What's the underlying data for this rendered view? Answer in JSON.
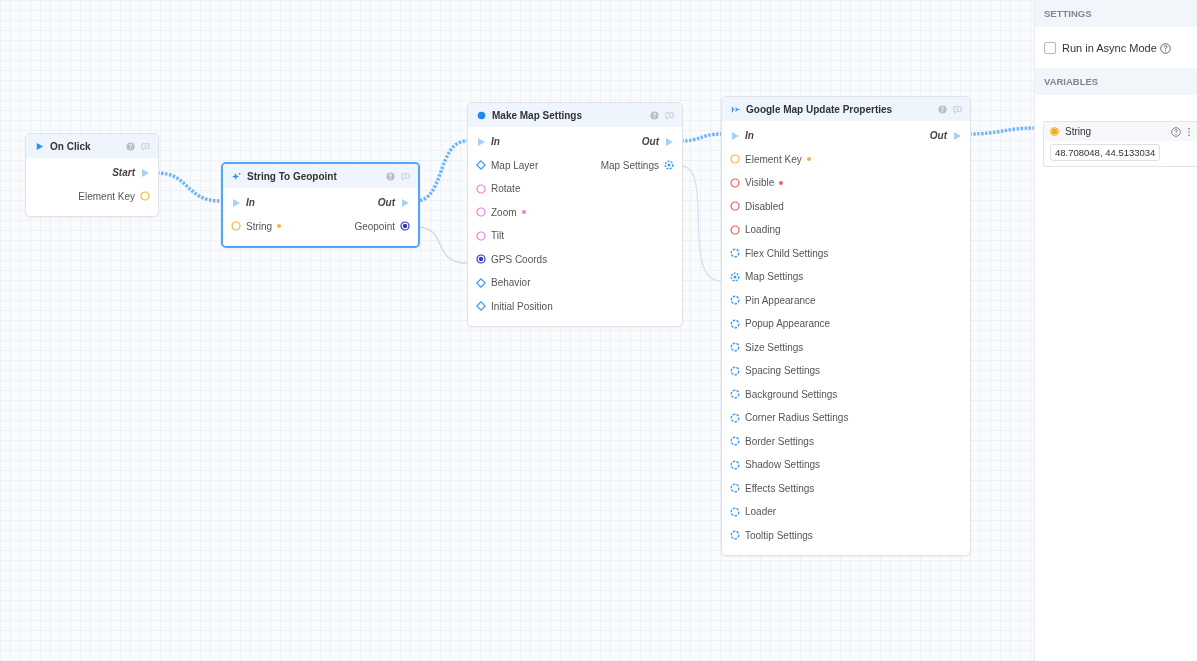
{
  "canvas": {
    "nodes": [
      {
        "title": "On Click",
        "selected": false,
        "outputs": [
          {
            "label": "Start",
            "kind": "exec",
            "required": false
          },
          {
            "label": "Element Key",
            "kind": "text",
            "required": false
          }
        ]
      },
      {
        "title": "String To Geopoint",
        "selected": true,
        "inputs": [
          {
            "label": "In",
            "kind": "exec",
            "required": false
          },
          {
            "label": "String",
            "kind": "text",
            "required": true
          }
        ],
        "outputs": [
          {
            "label": "Out",
            "kind": "exec",
            "required": false
          },
          {
            "label": "Geopoint",
            "kind": "geopoint",
            "required": false
          }
        ]
      },
      {
        "title": "Make Map Settings",
        "selected": false,
        "inputs": [
          {
            "label": "In",
            "kind": "exec",
            "required": false
          },
          {
            "label": "Map Layer",
            "kind": "enum",
            "required": false
          },
          {
            "label": "Rotate",
            "kind": "number",
            "required": false
          },
          {
            "label": "Zoom",
            "kind": "number",
            "required": true
          },
          {
            "label": "Tilt",
            "kind": "number",
            "required": false
          },
          {
            "label": "GPS Coords",
            "kind": "geopoint",
            "required": false
          },
          {
            "label": "Behavior",
            "kind": "enum",
            "required": false
          },
          {
            "label": "Initial Position",
            "kind": "enum",
            "required": false
          }
        ],
        "outputs": [
          {
            "label": "Out",
            "kind": "exec",
            "required": false
          },
          {
            "label": "Map Settings",
            "kind": "map",
            "required": false
          }
        ]
      },
      {
        "title": "Google Map Update Properties",
        "selected": false,
        "inputs": [
          {
            "label": "In",
            "kind": "exec",
            "required": false
          },
          {
            "label": "Element Key",
            "kind": "text",
            "required": true
          },
          {
            "label": "Visible",
            "kind": "boolean",
            "required": true
          },
          {
            "label": "Disabled",
            "kind": "boolean",
            "required": false
          },
          {
            "label": "Loading",
            "kind": "boolean",
            "required": false
          },
          {
            "label": "Flex Child Settings",
            "kind": "object",
            "required": false
          },
          {
            "label": "Map Settings",
            "kind": "map",
            "required": false
          },
          {
            "label": "Pin Appearance",
            "kind": "object",
            "required": false
          },
          {
            "label": "Popup Appearance",
            "kind": "object",
            "required": false
          },
          {
            "label": "Size Settings",
            "kind": "object",
            "required": false
          },
          {
            "label": "Spacing Settings",
            "kind": "object",
            "required": false
          },
          {
            "label": "Background Settings",
            "kind": "object",
            "required": false
          },
          {
            "label": "Corner Radius Settings",
            "kind": "object",
            "required": false
          },
          {
            "label": "Border Settings",
            "kind": "object",
            "required": false
          },
          {
            "label": "Shadow Settings",
            "kind": "object",
            "required": false
          },
          {
            "label": "Effects Settings",
            "kind": "object",
            "required": false
          },
          {
            "label": "Loader",
            "kind": "object",
            "required": false
          },
          {
            "label": "Tooltip Settings",
            "kind": "object",
            "required": false
          }
        ],
        "outputs": [
          {
            "label": "Out",
            "kind": "exec",
            "required": false
          }
        ]
      }
    ]
  },
  "sidebar": {
    "settings": {
      "heading": "SETTINGS",
      "options": [
        {
          "label": "Run in Async Mode",
          "checked": false
        }
      ]
    },
    "variables": {
      "heading": "VARIABLES",
      "items": [
        {
          "name": "String",
          "color": "#f5a623",
          "value": "48.708048, 44.5133034"
        }
      ]
    }
  }
}
